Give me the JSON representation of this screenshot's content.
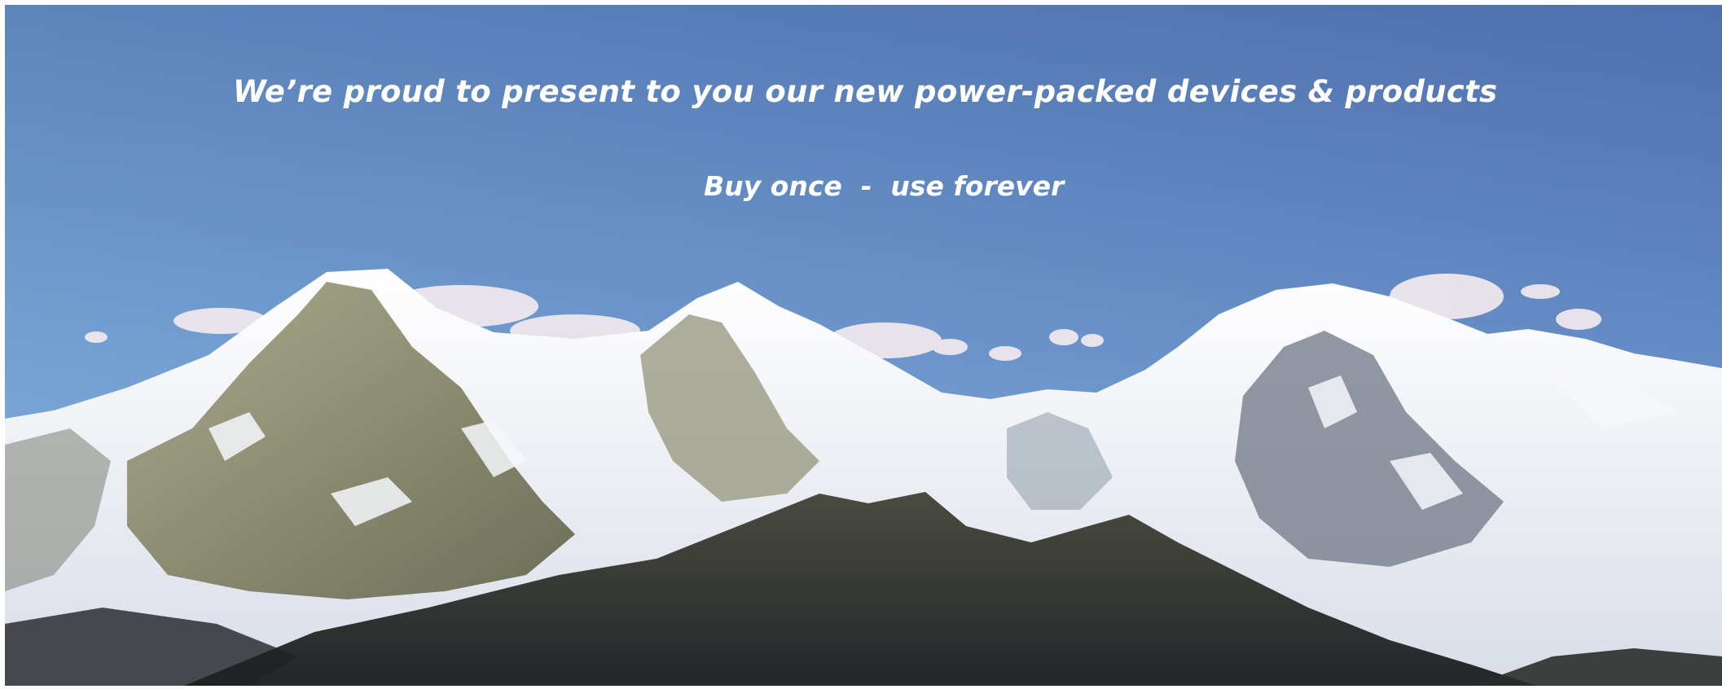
{
  "banner": {
    "headline": "We’re proud to present to you our new power-packed devices & products",
    "tagline": "Buy once  -  use forever"
  },
  "colors": {
    "sky_top": "#5b80b8",
    "sky_bottom": "#8ab8e0",
    "text": "#ffffff",
    "snow": "#f4f5f8",
    "rock": "#8c8d6c",
    "foreground_ridge": "#2b2e2d"
  }
}
